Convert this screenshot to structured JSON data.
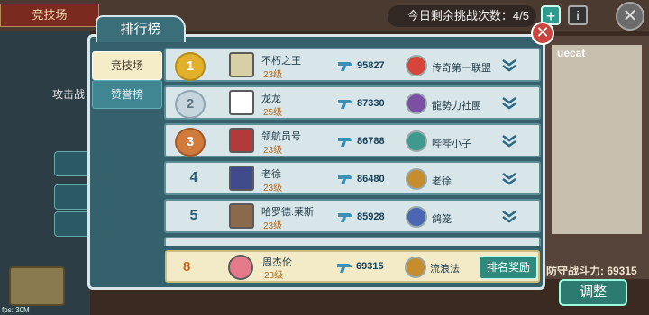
{
  "background": {
    "arena_tag": "竞技场",
    "challenges_left": "今日剩余挑战次数：4/5",
    "attack_label": "攻击战",
    "player_tag": "uecat",
    "defense_power": "防守战斗力: 69315",
    "adjust_button": "调整",
    "fps": "fps: 30M"
  },
  "modal": {
    "title": "排行榜",
    "tabs": [
      "竞技场",
      "赞誉榜"
    ],
    "rows": [
      {
        "rank": "1",
        "medal": "gold",
        "name": "不朽之王",
        "level": "23级",
        "power": "95827",
        "alliance": "传奇第一联盟",
        "ally_color": "#d7443a"
      },
      {
        "rank": "2",
        "medal": "silver",
        "name": "龙龙",
        "level": "25级",
        "power": "87330",
        "alliance": "龍勢力社團",
        "ally_color": "#7b4fa3"
      },
      {
        "rank": "3",
        "medal": "bronze",
        "name": "领航员号",
        "level": "23级",
        "power": "86788",
        "alliance": "哔哔小子",
        "ally_color": "#3e9a8c"
      },
      {
        "rank": "4",
        "medal": "",
        "name": "老徐",
        "level": "23级",
        "power": "86480",
        "alliance": "老徐",
        "ally_color": "#c58d2e"
      },
      {
        "rank": "5",
        "medal": "",
        "name": "哈罗德.莱斯",
        "level": "23级",
        "power": "85928",
        "alliance": "鸽笼",
        "ally_color": "#4b67b3"
      }
    ],
    "me": {
      "rank": "8",
      "name": "周杰伦",
      "level": "23级",
      "power": "69315",
      "alliance": "流浪法",
      "reward_button": "排名奖励"
    }
  }
}
